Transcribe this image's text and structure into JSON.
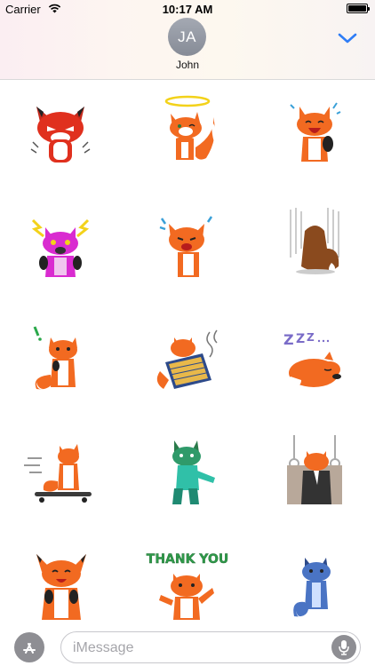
{
  "status_bar": {
    "carrier": "Carrier",
    "time": "10:17 AM"
  },
  "header": {
    "avatar_initials": "JA",
    "contact_name": "John",
    "collapse_icon": "chevron-down-icon"
  },
  "colors": {
    "accent": "#2f7df6",
    "fox_orange": "#f26a21",
    "fox_dark": "#222222",
    "fox_white": "#ffffff"
  },
  "stickers": [
    {
      "name": "sticker-angry-fox"
    },
    {
      "name": "sticker-angel-fox"
    },
    {
      "name": "sticker-laughing-fox"
    },
    {
      "name": "sticker-shocked-fox"
    },
    {
      "name": "sticker-crying-fox"
    },
    {
      "name": "sticker-gloomy-fox"
    },
    {
      "name": "sticker-idea-fox"
    },
    {
      "name": "sticker-reading-fox"
    },
    {
      "name": "sticker-sleeping-fox"
    },
    {
      "name": "sticker-skateboard-fox"
    },
    {
      "name": "sticker-zombie-fox"
    },
    {
      "name": "sticker-commuter-fox"
    },
    {
      "name": "sticker-cheering-fox"
    },
    {
      "name": "sticker-thank-you-fox",
      "caption": "THANK YOU"
    },
    {
      "name": "sticker-blue-fox"
    }
  ],
  "composer": {
    "placeholder": "iMessage",
    "app_store_icon": "app-store-icon",
    "mic_icon": "microphone-icon"
  }
}
